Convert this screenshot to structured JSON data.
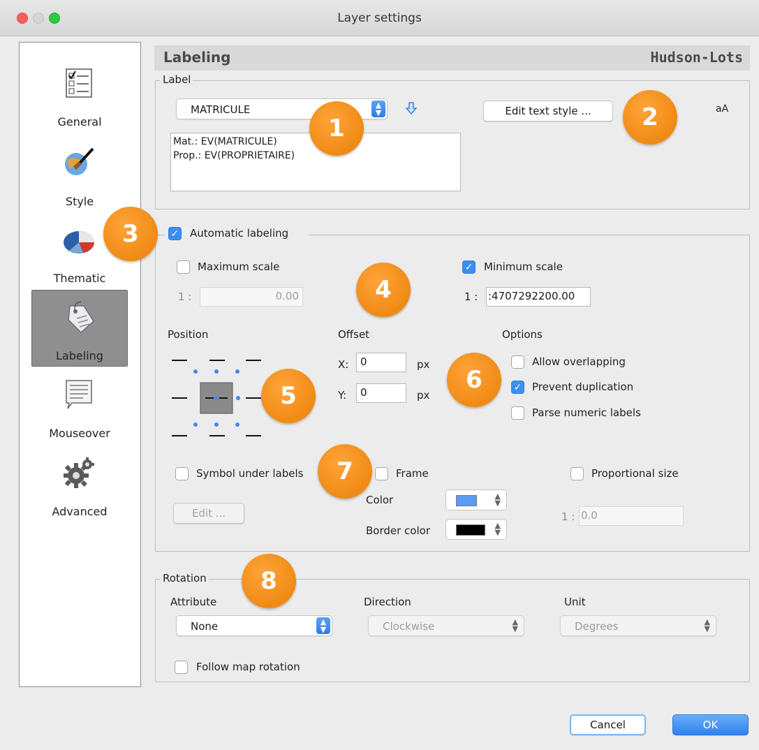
{
  "window": {
    "title": "Layer settings"
  },
  "sidebar": {
    "items": [
      {
        "label": "General",
        "icon": "checklist-icon"
      },
      {
        "label": "Style",
        "icon": "brush-icon"
      },
      {
        "label": "Thematic",
        "icon": "pie-icon"
      },
      {
        "label": "Labeling",
        "icon": "tag-icon",
        "active": true
      },
      {
        "label": "Mouseover",
        "icon": "note-icon"
      },
      {
        "label": "Advanced",
        "icon": "gear-icon"
      }
    ]
  },
  "header": {
    "left": "Labeling",
    "right": "Hudson-Lots"
  },
  "label_group": {
    "legend": "Label",
    "attribute": "MATRICULE",
    "edit_text_style": "Edit text style ...",
    "font_preview": "aA",
    "expression_lines": [
      "Mat.: EV(MATRICULE)",
      "Prop.: EV(PROPRIETAIRE)"
    ]
  },
  "auto_group": {
    "legend": "Automatic labeling",
    "checked": true,
    "max_scale_label": "Maximum scale",
    "max_scale_checked": false,
    "max_scale_prefix": "1 :",
    "max_scale_value": "0.00",
    "min_scale_label": "Minimum scale",
    "min_scale_checked": true,
    "min_scale_prefix": "1 :",
    "min_scale_value": ":4707292200.00",
    "position_label": "Position",
    "offset_label": "Offset",
    "offset_x_label": "X:",
    "offset_x_value": "0",
    "offset_x_unit": "px",
    "offset_y_label": "Y:",
    "offset_y_value": "0",
    "offset_y_unit": "px",
    "options_label": "Options",
    "options": [
      {
        "label": "Allow overlapping",
        "checked": false
      },
      {
        "label": "Prevent duplication",
        "checked": true
      },
      {
        "label": "Parse numeric labels",
        "checked": false
      }
    ],
    "symbol_under_labels": "Symbol under labels",
    "edit_button": "Edit ...",
    "frame_label": "Frame",
    "color_label": "Color",
    "color_value": "#5b9af5",
    "border_color_label": "Border color",
    "border_color_value": "#000000",
    "proportional_label": "Proportional size",
    "proportional_prefix": "1 :",
    "proportional_value": "0.0"
  },
  "rotation_group": {
    "legend": "Rotation",
    "attribute_label": "Attribute",
    "attribute_value": "None",
    "direction_label": "Direction",
    "direction_value": "Clockwise",
    "unit_label": "Unit",
    "unit_value": "Degrees",
    "follow_map_rotation": "Follow map rotation"
  },
  "footer": {
    "cancel": "Cancel",
    "ok": "OK"
  },
  "callouts": [
    "1",
    "2",
    "3",
    "4",
    "5",
    "6",
    "7",
    "8"
  ]
}
